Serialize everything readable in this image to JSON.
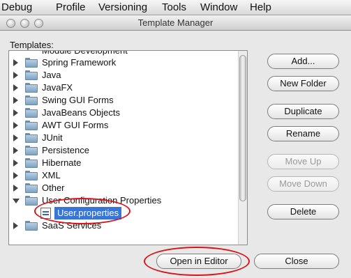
{
  "menubar": {
    "items": [
      "Debug",
      "Profile",
      "Versioning",
      "Tools",
      "Window",
      "Help"
    ]
  },
  "window": {
    "title": "Template Manager"
  },
  "templates_label": "Templates:",
  "tree": {
    "partial_top_label": "Module Development",
    "rows": [
      {
        "label": "Spring Framework",
        "expanded": false
      },
      {
        "label": "Java",
        "expanded": false
      },
      {
        "label": "JavaFX",
        "expanded": false
      },
      {
        "label": "Swing GUI Forms",
        "expanded": false
      },
      {
        "label": "JavaBeans Objects",
        "expanded": false
      },
      {
        "label": "AWT GUI Forms",
        "expanded": false
      },
      {
        "label": "JUnit",
        "expanded": false
      },
      {
        "label": "Persistence",
        "expanded": false
      },
      {
        "label": "Hibernate",
        "expanded": false
      },
      {
        "label": "XML",
        "expanded": false
      },
      {
        "label": "Other",
        "expanded": false
      },
      {
        "label": "User Configuration Properties",
        "expanded": true
      }
    ],
    "selected_child": "User.properties",
    "bottom_row": "SaaS Services"
  },
  "buttons": {
    "add": "Add...",
    "new_folder": "New Folder",
    "duplicate": "Duplicate",
    "rename": "Rename",
    "move_up": "Move Up",
    "move_down": "Move Down",
    "delete": "Delete",
    "open_in_editor": "Open in Editor",
    "close": "Close"
  },
  "colors": {
    "selection": "#3875d7",
    "annotation": "#d9141b"
  }
}
